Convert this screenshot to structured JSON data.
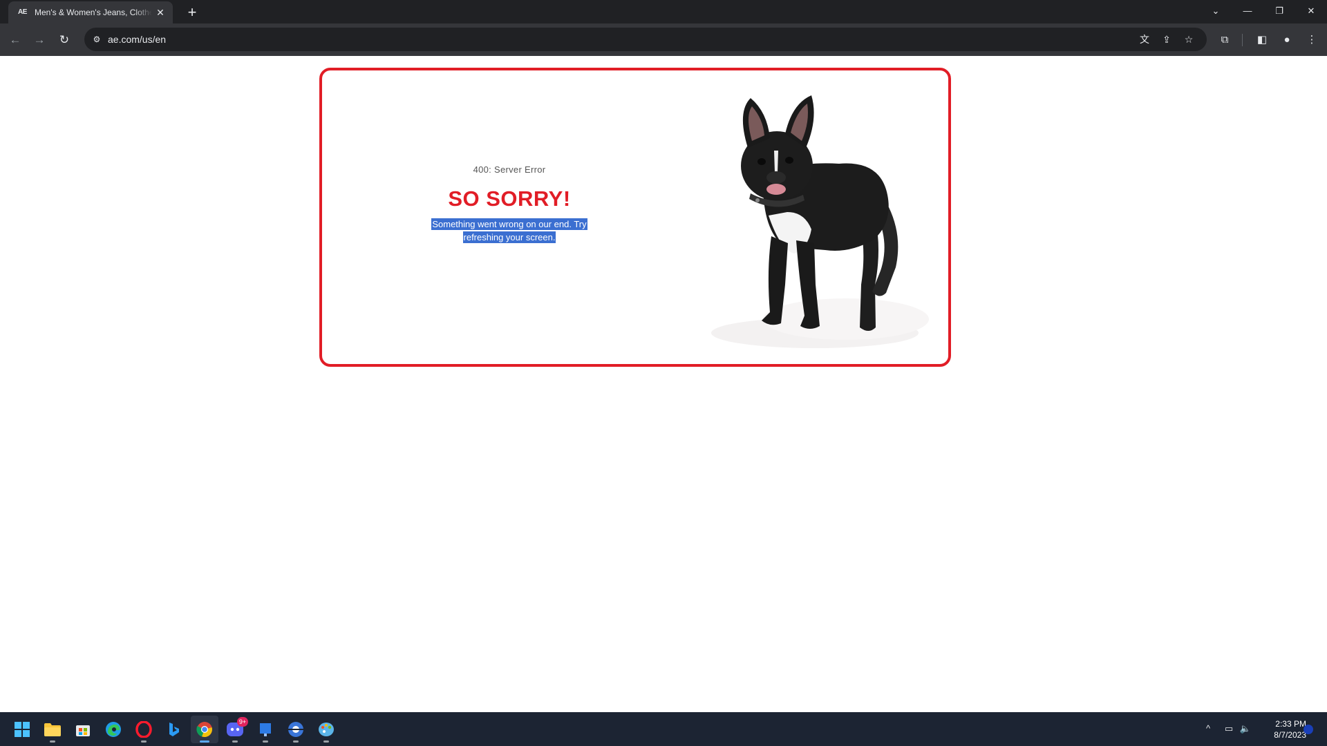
{
  "browser": {
    "tab": {
      "favicon_text": "AE",
      "title": "Men's & Women's Jeans, Clothes & Accessories | American Eagle",
      "close_glyph": "✕"
    },
    "new_tab_glyph": "+",
    "window_controls": {
      "tab_search": "⌄",
      "minimize": "—",
      "restore": "❐",
      "close": "✕"
    },
    "toolbar": {
      "back": "←",
      "forward": "→",
      "reload": "↻",
      "site_info": "⚙",
      "url": "ae.com/us/en",
      "translate": "文",
      "share": "⇪",
      "bookmark": "☆",
      "extensions": "⧉",
      "side_panel": "◧",
      "profile": "●",
      "menu": "⋮"
    }
  },
  "page": {
    "error_code": "400: Server Error",
    "heading": "SO SORRY!",
    "message_line1": "Something went wrong on our end. Try",
    "message_line2": "refreshing your screen.",
    "colors": {
      "accent_red": "#e11d26",
      "selection_blue": "#3b6fd1"
    }
  },
  "taskbar": {
    "apps": [
      "start",
      "file-explorer",
      "microsoft-store",
      "edge",
      "opera",
      "bing",
      "chrome",
      "discord",
      "windows-app",
      "pokeball-app",
      "paint-app"
    ],
    "discord_badge": "9+",
    "tray": {
      "chevron": "^",
      "network": "▭",
      "volume": "🔈"
    },
    "time": "2:33 PM",
    "date": "8/7/2023"
  }
}
